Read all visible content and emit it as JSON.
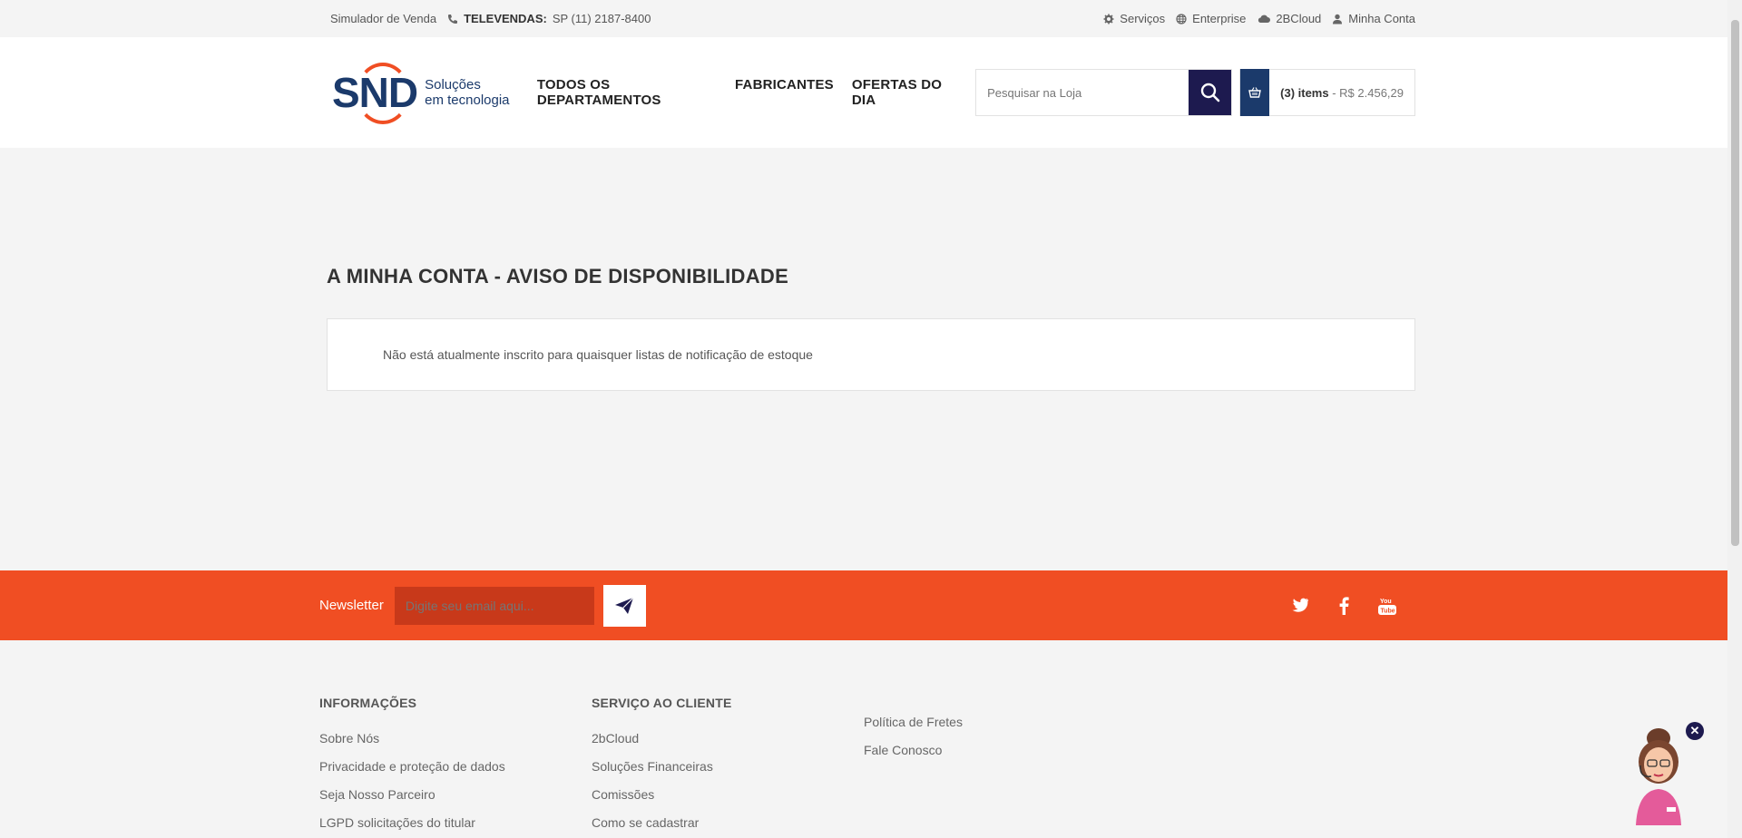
{
  "topbar": {
    "simulator": "Simulador de Venda",
    "televendas_label": "TELEVENDAS:",
    "televendas_phone": "SP (11)  2187-8400",
    "links": [
      "Serviços",
      "Enterprise",
      "2BCloud",
      "Minha Conta"
    ]
  },
  "header": {
    "logo_text": "SND",
    "logo_tagline_1": "Soluções",
    "logo_tagline_2": "em tecnologia",
    "nav": [
      "TODOS OS DEPARTAMENTOS",
      "FABRICANTES",
      "OFERTAS DO DIA"
    ],
    "search_placeholder": "Pesquisar na Loja",
    "cart_items": "(3) items",
    "cart_total": " - R$ 2.456,29"
  },
  "main": {
    "title": "A MINHA CONTA - AVISO DE DISPONIBILIDADE",
    "notice": "Não está atualmente inscrito para quaisquer listas de notificação de estoque"
  },
  "newsletter": {
    "label": "Newsletter",
    "placeholder": "Digite seu email aqui...",
    "colors": {
      "band": "#f04e23",
      "input": "#c8391a"
    }
  },
  "footer": {
    "informacoes": {
      "heading": "INFORMAÇÕES",
      "links": [
        "Sobre Nós",
        "Privacidade e proteção de dados",
        "Seja Nosso Parceiro",
        "LGPD solicitações do titular"
      ]
    },
    "servico": {
      "heading": "SERVIÇO AO CLIENTE",
      "links": [
        "2bCloud",
        "Soluções Financeiras",
        "Comissões",
        "Como se cadastrar"
      ]
    },
    "extra": {
      "links": [
        "Política de Fretes",
        "Fale Conosco"
      ]
    }
  },
  "colors": {
    "accent": "#f04e23",
    "brand": "#1b3a6b",
    "dark_button": "#1d1a4f"
  }
}
